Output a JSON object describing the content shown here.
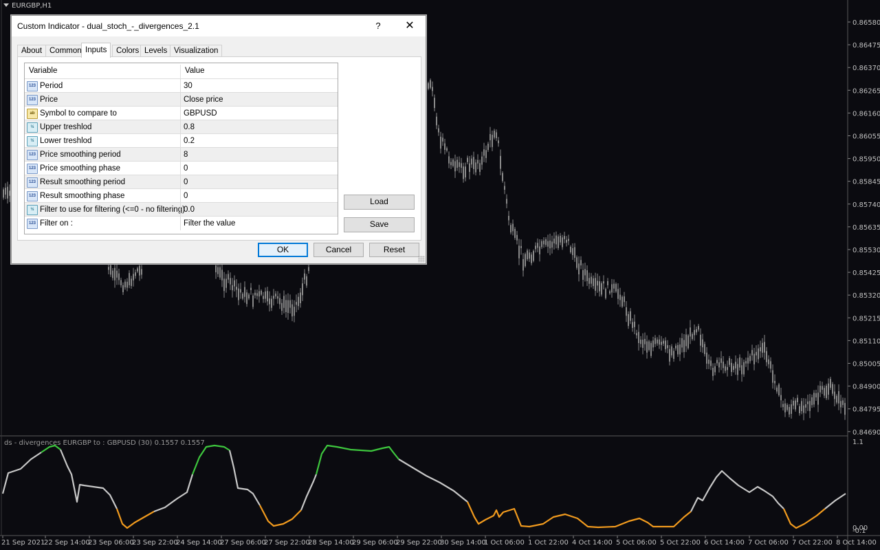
{
  "chart": {
    "symbol_title": "EURGBP,H1",
    "indicator_title": "ds - divergences EURGBP to : GBPUSD (30) 0.1557 0.1557",
    "price_axis": [
      "0.86580",
      "0.86475",
      "0.86370",
      "0.86265",
      "0.86160",
      "0.86055",
      "0.85950",
      "0.85845",
      "0.85740",
      "0.85635",
      "0.85530",
      "0.85425",
      "0.85320",
      "0.85215",
      "0.85110",
      "0.85005",
      "0.84900",
      "0.84795",
      "0.84690"
    ],
    "indicator_axis": [
      "1.1",
      "0.00",
      "-0.1"
    ],
    "time_axis": [
      "21 Sep 2021",
      "22 Sep 14:00",
      "23 Sep 06:00",
      "23 Sep 22:00",
      "24 Sep 14:00",
      "27 Sep 06:00",
      "27 Sep 22:00",
      "28 Sep 14:00",
      "29 Sep 06:00",
      "29 Sep 22:00",
      "30 Sep 14:00",
      "1 Oct 06:00",
      "1 Oct 22:00",
      "4 Oct 14:00",
      "5 Oct 06:00",
      "5 Oct 22:00",
      "6 Oct 14:00",
      "7 Oct 06:00",
      "7 Oct 22:00",
      "8 Oct 14:00"
    ],
    "colors": {
      "background": "#0b0b10",
      "candle": "#8a8a8a",
      "neutral": "#c8c8c8",
      "up": "#3ec83e",
      "down": "#f29b1e",
      "axis_text": "#c0c0c0"
    }
  },
  "dialog": {
    "title": "Custom Indicator - dual_stoch_-_divergences_2.1",
    "help_label": "?",
    "close_label": "✕",
    "tabs": [
      {
        "label": "About",
        "active": false
      },
      {
        "label": "Common",
        "active": false
      },
      {
        "label": "Inputs",
        "active": true
      },
      {
        "label": "Colors",
        "active": false
      },
      {
        "label": "Levels",
        "active": false
      },
      {
        "label": "Visualization",
        "active": false
      }
    ],
    "columns": {
      "variable": "Variable",
      "value": "Value"
    },
    "rows": [
      {
        "icon": "int-icon",
        "icon_text": "123",
        "variable": "Period",
        "value": "30"
      },
      {
        "icon": "int-icon",
        "icon_text": "123",
        "variable": "Price",
        "value": "Close price"
      },
      {
        "icon": "text-icon",
        "icon_text": "ab",
        "variable": "Symbol to compare to",
        "value": "GBPUSD"
      },
      {
        "icon": "double-icon",
        "icon_text": "½",
        "variable": "Upper treshlod",
        "value": "0.8"
      },
      {
        "icon": "double-icon",
        "icon_text": "½",
        "variable": "Lower treshlod",
        "value": "0.2"
      },
      {
        "icon": "int-icon",
        "icon_text": "123",
        "variable": "Price smoothing period",
        "value": "8"
      },
      {
        "icon": "int-icon",
        "icon_text": "123",
        "variable": "Price smoothing phase",
        "value": "0"
      },
      {
        "icon": "int-icon",
        "icon_text": "123",
        "variable": "Result smoothing period",
        "value": "0"
      },
      {
        "icon": "int-icon",
        "icon_text": "123",
        "variable": "Result smoothing phase",
        "value": "0"
      },
      {
        "icon": "double-icon",
        "icon_text": "½",
        "variable": "Filter to use for filtering (<=0 - no filtering)",
        "value": "0.0"
      },
      {
        "icon": "int-icon",
        "icon_text": "123",
        "variable": "Filter on :",
        "value": "Filter the value"
      }
    ],
    "buttons": {
      "load": "Load",
      "save": "Save",
      "ok": "OK",
      "cancel": "Cancel",
      "reset": "Reset"
    }
  }
}
